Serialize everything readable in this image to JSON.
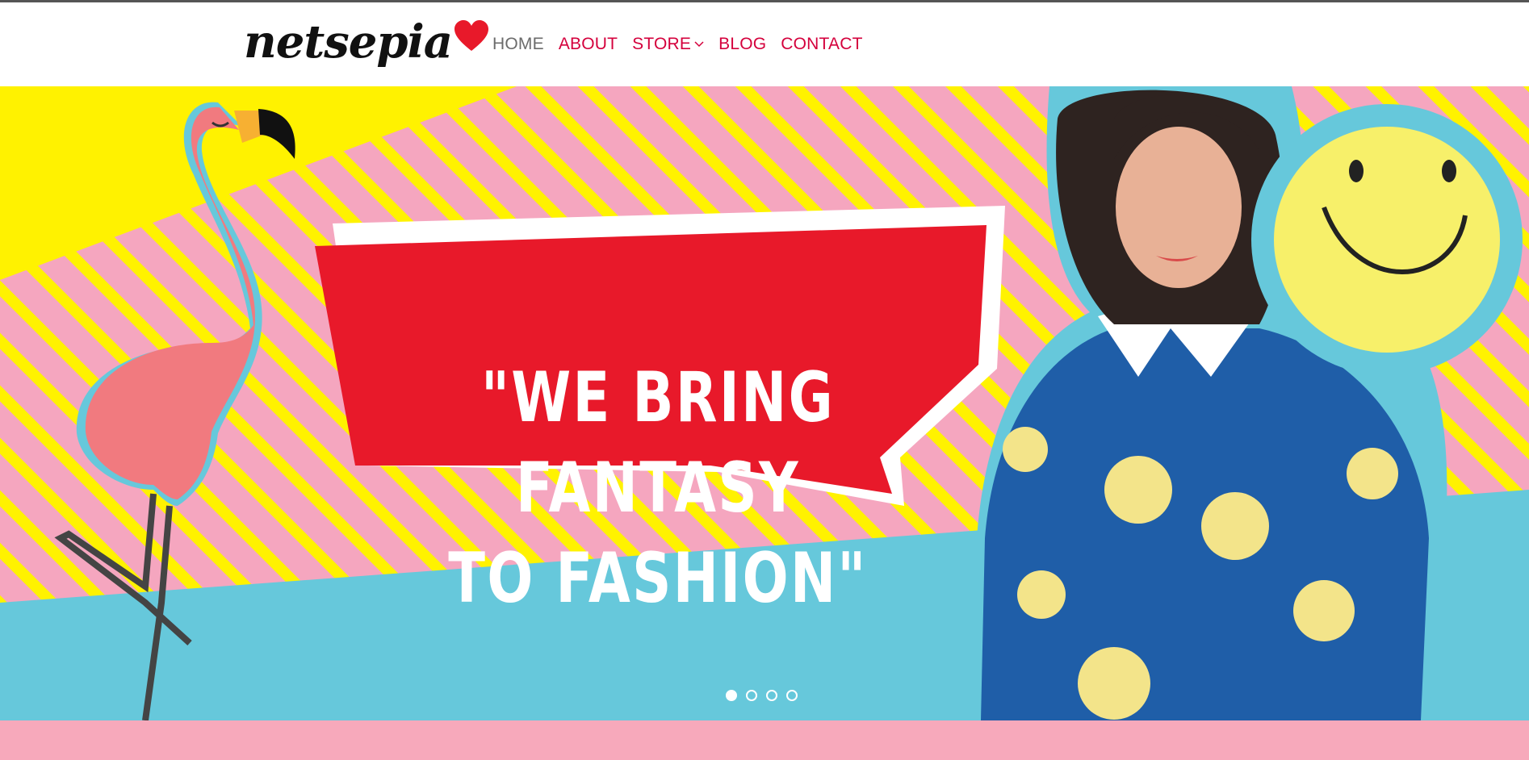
{
  "brand": {
    "name": "netsepia"
  },
  "nav": {
    "items": [
      {
        "label": "HOME",
        "active": true
      },
      {
        "label": "ABOUT",
        "active": false
      },
      {
        "label": "STORE",
        "active": false,
        "has_dropdown": true
      },
      {
        "label": "BLOG",
        "active": false
      },
      {
        "label": "CONTACT",
        "active": false
      }
    ]
  },
  "hero": {
    "quote_line1": "\"WE BRING FANTASY",
    "quote_line2": "TO FASHION\"",
    "slides_total": 4,
    "slide_active": 1
  },
  "colors": {
    "nav_text": "#d4003c",
    "nav_active": "#6b6b6b",
    "bubble_red": "#e8192a",
    "stripe_yellow": "#fff200",
    "stripe_pink": "#f5a6bf",
    "sky_blue": "#66c8db",
    "footer_pink": "#f7a9bb"
  },
  "icons": {
    "logo_heart": "heart-icon",
    "dropdown": "chevron-down-icon"
  }
}
